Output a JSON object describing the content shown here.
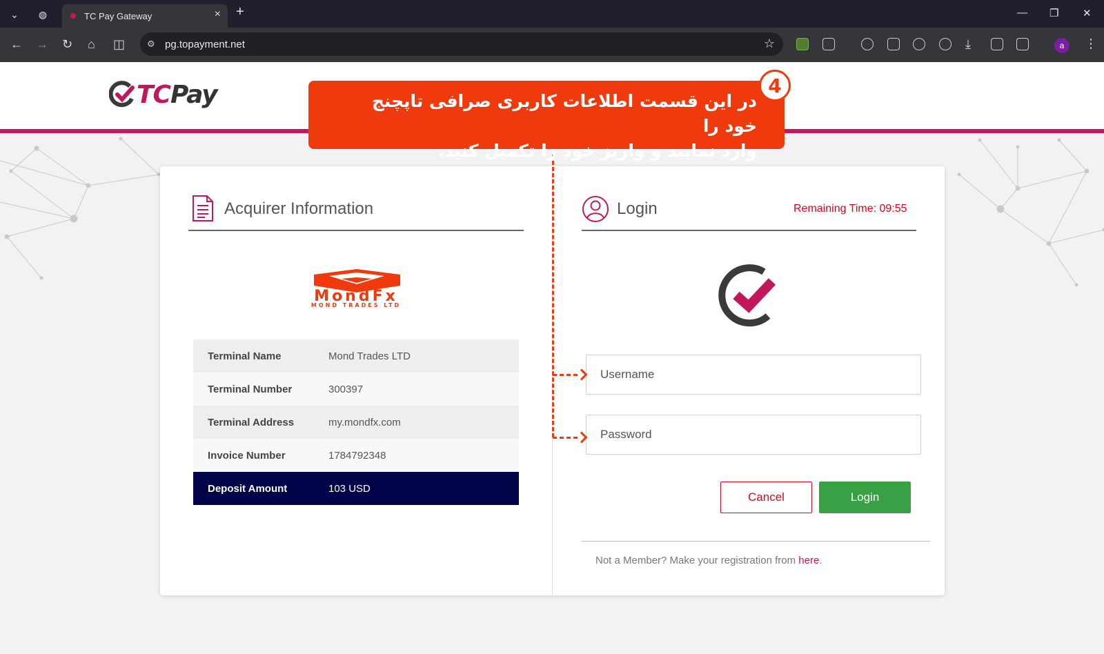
{
  "browser": {
    "tab_title": "TC Pay Gateway",
    "new_tab": "+",
    "url": "pg.topayment.net",
    "profile_initial": "a"
  },
  "header": {
    "logo_text": "TCPay"
  },
  "banner": {
    "step": "4",
    "line1": "در این قسمت اطلاعات کاربری صرافی تاپچنج خود را",
    "line2": "وارد نمایید و واریز خود را تکمیل کنید."
  },
  "acquirer": {
    "title": "Acquirer Information",
    "merchant_logo_text": "MondFx",
    "merchant_logo_subtext": "MOND TRADES LTD",
    "rows": [
      {
        "label": "Terminal Name",
        "value": "Mond Trades LTD"
      },
      {
        "label": "Terminal Number",
        "value": "300397"
      },
      {
        "label": "Terminal Address",
        "value": "my.mondfx.com"
      },
      {
        "label": "Invoice Number",
        "value": "1784792348"
      },
      {
        "label": "Deposit Amount",
        "value": "103 USD"
      }
    ]
  },
  "login": {
    "title": "Login",
    "remaining_label": "Remaining Time:",
    "remaining_value": "09:55",
    "username_placeholder": "Username",
    "password_placeholder": "Password",
    "cancel_label": "Cancel",
    "login_label": "Login",
    "register_text": "Not a Member? Make your registration from ",
    "register_link": "here",
    "register_end": "."
  },
  "colors": {
    "brand": "#c2185b",
    "banner": "#ef3a0e",
    "deposit_row": "#020348",
    "login_button": "#3aa045",
    "cancel_border": "#e2001a"
  }
}
